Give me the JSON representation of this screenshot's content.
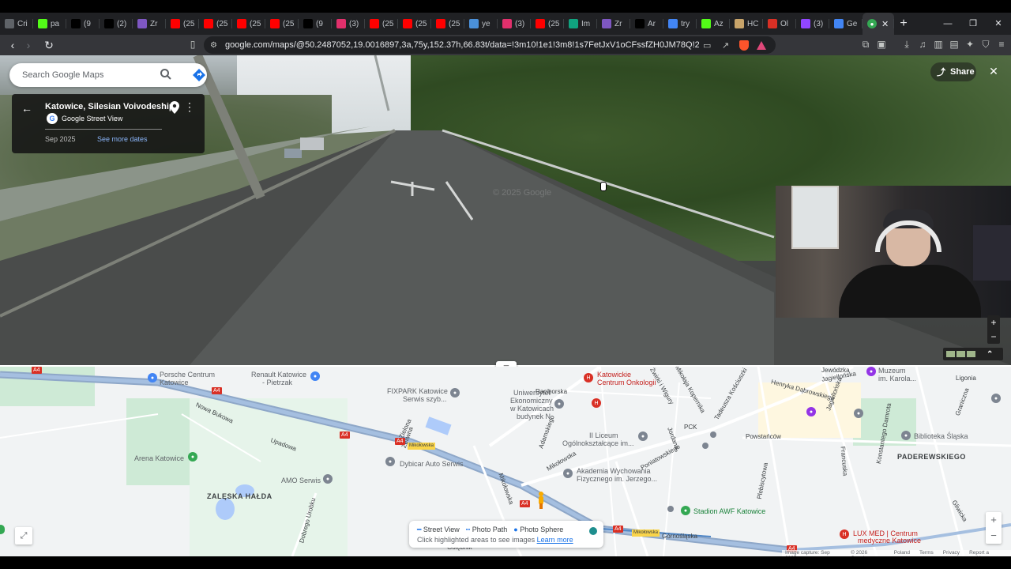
{
  "browser": {
    "tabs": [
      {
        "label": "Cri",
        "color": "#5f6368",
        "icon": "stack-icon"
      },
      {
        "label": "pa",
        "color": "#53fc18",
        "icon": "kick-icon"
      },
      {
        "label": "(9",
        "color": "#000000",
        "icon": "tiktok-icon"
      },
      {
        "label": "(2)",
        "color": "#000000",
        "icon": "x-icon"
      },
      {
        "label": "Zr",
        "color": "#7e57c2",
        "icon": "feather-icon"
      },
      {
        "label": "(25",
        "color": "#ff0000",
        "icon": "youtube-icon"
      },
      {
        "label": "(25",
        "color": "#ff0000",
        "icon": "youtube-icon"
      },
      {
        "label": "(25",
        "color": "#ff0000",
        "icon": "youtube-icon"
      },
      {
        "label": "(25",
        "color": "#ff0000",
        "icon": "youtube-icon"
      },
      {
        "label": "(9",
        "color": "#000000",
        "icon": "tiktok-icon"
      },
      {
        "label": "(3)",
        "color": "#e1306c",
        "icon": "instagram-icon"
      },
      {
        "label": "(25",
        "color": "#ff0000",
        "icon": "youtube-icon"
      },
      {
        "label": "(25",
        "color": "#ff0000",
        "icon": "youtube-icon"
      },
      {
        "label": "(25",
        "color": "#ff0000",
        "icon": "youtube-icon"
      },
      {
        "label": "ye",
        "color": "#4a90d9",
        "icon": "image-icon"
      },
      {
        "label": "(3)",
        "color": "#e1306c",
        "icon": "instagram-icon"
      },
      {
        "label": "(25",
        "color": "#ff0000",
        "icon": "youtube-icon"
      },
      {
        "label": "Im",
        "color": "#10a37f",
        "icon": "translate-icon"
      },
      {
        "label": "Zr",
        "color": "#7e57c2",
        "icon": "feather-icon"
      },
      {
        "label": "Ar",
        "color": "#000000",
        "icon": "tiktok-icon"
      },
      {
        "label": "try",
        "color": "#4285f4",
        "icon": "google-icon"
      },
      {
        "label": "Az",
        "color": "#53fc18",
        "icon": "kick-icon"
      },
      {
        "label": "HC",
        "color": "#c8a46a",
        "icon": "hat-icon"
      },
      {
        "label": "Ol",
        "color": "#d93025",
        "icon": "flag-icon"
      },
      {
        "label": "(3)",
        "color": "#9146ff",
        "icon": "twitch-icon"
      },
      {
        "label": "Ge",
        "color": "#4285f4",
        "icon": "gemini-icon"
      }
    ],
    "active_tab": {
      "color": "#34a853",
      "icon": "google-maps-icon"
    },
    "url": "google.com/maps/@50.2487052,19.0016897,3a,75y,152.37h,66.83t/data=!3m10!1e1!3m8!1s7FetJxV1oCFssfZH0JM78Q!2e0!6shttps:%2F%2Fstre..."
  },
  "streetview": {
    "search_placeholder": "Search Google Maps",
    "location_title": "Katowice, Silesian Voivodeship",
    "source": "Google Street View",
    "date": "Sep 2025",
    "see_more_dates": "See more dates",
    "watermark": "© 2025 Google",
    "share_label": "Share"
  },
  "map": {
    "labels": [
      {
        "text": "Porsche Centrum",
        "cls": "blue"
      },
      {
        "text": "Katowice",
        "cls": "blue"
      },
      {
        "text": "Renault Katowice",
        "cls": "blue"
      },
      {
        "text": "- Pietrzak",
        "cls": "blue"
      },
      {
        "text": "FIXPARK Katowice",
        "cls": ""
      },
      {
        "text": "Serwis szyb...",
        "cls": ""
      },
      {
        "text": "Uniwersytet",
        "cls": ""
      },
      {
        "text": "Ekonomiczny",
        "cls": ""
      },
      {
        "text": "w Katowicach",
        "cls": ""
      },
      {
        "text": "budynek N",
        "cls": ""
      },
      {
        "text": "Katowickie",
        "cls": "red"
      },
      {
        "text": "Centrum Onkologii",
        "cls": "red"
      },
      {
        "text": "II Liceum",
        "cls": ""
      },
      {
        "text": "Ogólnokształcące im...",
        "cls": ""
      },
      {
        "text": "Akademia Wychowania",
        "cls": ""
      },
      {
        "text": "Fizycznego im. Jerzego...",
        "cls": ""
      },
      {
        "text": "Arena Katowice",
        "cls": ""
      },
      {
        "text": "Dybicar Auto Serwis",
        "cls": ""
      },
      {
        "text": "AMO Serwis",
        "cls": ""
      },
      {
        "text": "ZALĘSKA HAŁDA",
        "cls": "bold"
      },
      {
        "text": "Stadion AWF Katowice",
        "cls": "green"
      },
      {
        "text": "Biblioteka Śląska",
        "cls": ""
      },
      {
        "text": "PADEREWSKIEGO",
        "cls": "bold"
      },
      {
        "text": "Muzeum",
        "cls": ""
      },
      {
        "text": "im. Karola...",
        "cls": ""
      },
      {
        "text": "LUX MED | Centrum",
        "cls": "red"
      },
      {
        "text": "medyczne Katowice",
        "cls": "red"
      },
      {
        "text": "Powstańców",
        "cls": ""
      },
      {
        "text": "Raciborska",
        "cls": ""
      },
      {
        "text": "Nowa Bukowa",
        "cls": ""
      },
      {
        "text": "Upadowa",
        "cls": ""
      },
      {
        "text": "Mikołowska",
        "cls": ""
      },
      {
        "text": "Poniatowskiego",
        "cls": ""
      },
      {
        "text": "Jordana",
        "cls": ""
      },
      {
        "text": "PCK",
        "cls": ""
      },
      {
        "text": "Tadeusza Kościuszki",
        "cls": ""
      },
      {
        "text": "Henryka Dąbrowskiego",
        "cls": ""
      },
      {
        "text": "Jagiellońska",
        "cls": ""
      },
      {
        "text": "Francuska",
        "cls": ""
      },
      {
        "text": "Konstantego Damrota",
        "cls": ""
      },
      {
        "text": "Graniczna",
        "cls": ""
      },
      {
        "text": "Zielona",
        "cls": ""
      },
      {
        "text": "Dobrego Urobku",
        "cls": ""
      },
      {
        "text": "Górnośląska",
        "cls": ""
      },
      {
        "text": "Mikołaja Kopernika",
        "cls": ""
      },
      {
        "text": "Żeliwna",
        "cls": ""
      },
      {
        "text": "Adamskiego",
        "cls": ""
      },
      {
        "text": "Plebiscytowa",
        "cls": ""
      },
      {
        "text": "Jagiellońska",
        "cls": ""
      },
      {
        "text": "Ligonia",
        "cls": ""
      },
      {
        "text": "Gliwicka",
        "cls": ""
      },
      {
        "text": "Gołębnik",
        "cls": ""
      },
      {
        "text": "Żwirki i Wigury",
        "cls": ""
      },
      {
        "text": "Mikołowska",
        "cls": ""
      },
      {
        "text": "Jewódzka",
        "cls": ""
      }
    ],
    "shields": [
      "A4",
      "A4",
      "A4",
      "A4",
      "A4",
      "A4",
      "A4"
    ],
    "yellow_tags": [
      "Mikołowska",
      "Mikołowska"
    ],
    "legend": {
      "street_view": "Street View",
      "photo_path": "Photo Path",
      "photo_sphere": "Photo Sphere",
      "hint": "Click highlighted areas to see images",
      "learn_more": "Learn more"
    },
    "attribution": [
      "Image capture: Sep 2025",
      "© 2026 Google",
      "Poland",
      "Terms",
      "Privacy",
      "Report a problem"
    ]
  }
}
